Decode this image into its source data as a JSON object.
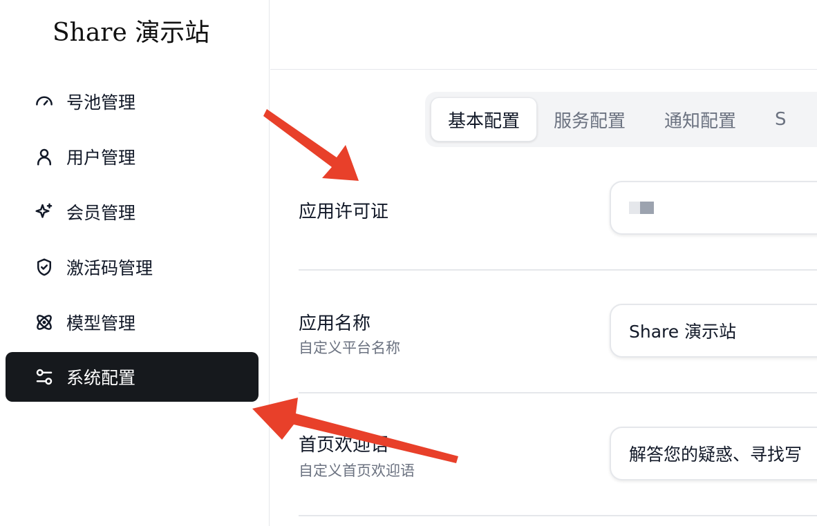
{
  "brand": "Share 演示站",
  "sidebar": {
    "items": [
      {
        "label": "号池管理",
        "icon": "gauge-icon"
      },
      {
        "label": "用户管理",
        "icon": "user-icon"
      },
      {
        "label": "会员管理",
        "icon": "sparkles-icon"
      },
      {
        "label": "激活码管理",
        "icon": "shield-check-icon"
      },
      {
        "label": "模型管理",
        "icon": "atom-icon"
      },
      {
        "label": "系统配置",
        "icon": "settings-toggle-icon",
        "active": true
      }
    ]
  },
  "tabs": [
    "基本配置",
    "服务配置",
    "通知配置",
    "S"
  ],
  "active_tab": "基本配置",
  "settings": [
    {
      "label": "应用许可证",
      "subtitle": "",
      "value": ""
    },
    {
      "label": "应用名称",
      "subtitle": "自定义平台名称",
      "value": "Share 演示站"
    },
    {
      "label": "首页欢迎语",
      "subtitle": "自定义首页欢迎语",
      "value": "解答您的疑惑、寻找写"
    }
  ],
  "colors": {
    "active_nav_bg": "#16191d",
    "annotation_arrow": "#e8402a",
    "muted_text": "#6b7280"
  }
}
